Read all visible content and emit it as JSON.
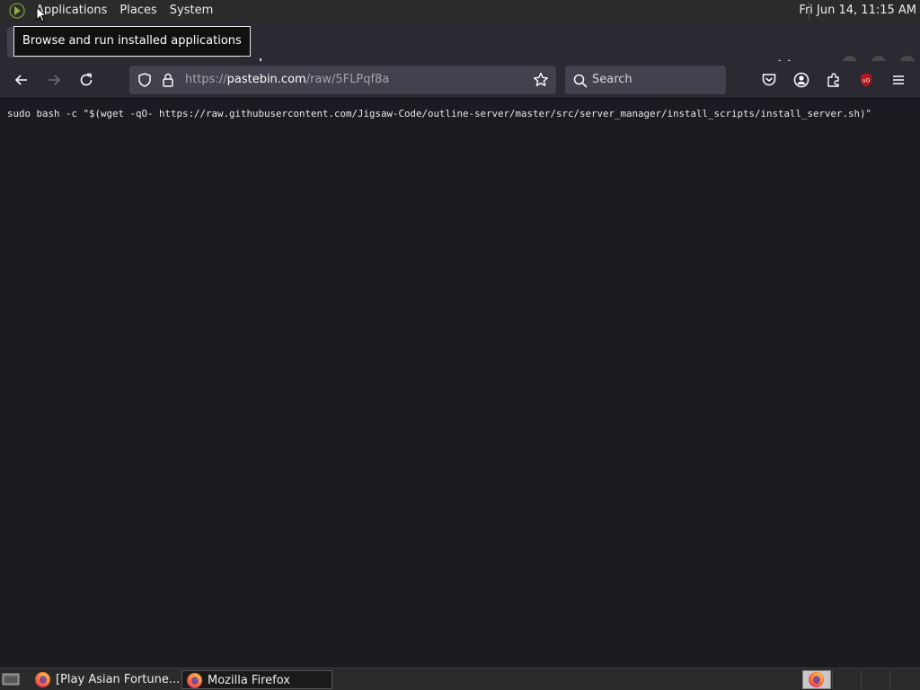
{
  "top_panel": {
    "menus": [
      "Applications",
      "Places",
      "System"
    ],
    "clock": "Fri Jun 14, 11:15 AM"
  },
  "tooltip": {
    "text": "Browse and run installed applications"
  },
  "nav": {
    "url_scheme": "https://",
    "url_host": "pastebin.com",
    "url_path": "/raw/5FLPqf8a",
    "search_placeholder": "Search"
  },
  "content": {
    "text": "sudo bash -c \"$(wget -qO- https://raw.githubusercontent.com/Jigsaw-Code/outline-server/master/src/server_manager/install_scripts/install_server.sh)\""
  },
  "taskbar": {
    "tasks": [
      {
        "label": "[Play Asian Fortune...",
        "active": false
      },
      {
        "label": "Mozilla Firefox",
        "active": true
      }
    ]
  },
  "colors": {
    "page_bg": "#1c1b22",
    "toolbar_bg": "#2b2a33",
    "field_bg": "#42414d",
    "panel_bg": "#2b2b2b",
    "ublock_red": "#b5161d"
  }
}
